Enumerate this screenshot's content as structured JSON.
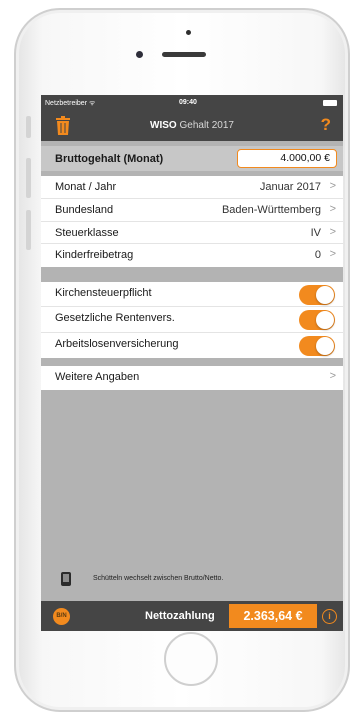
{
  "status_bar": {
    "carrier": "Netzbetreiber ᯤ",
    "time": "09:40"
  },
  "nav": {
    "title_bold": "WISO",
    "title_rest": " Gehalt 2017",
    "left_icon": "trash-icon",
    "right_icon": "help-icon",
    "help_glyph": "?"
  },
  "brutto": {
    "label": "Bruttogehalt (Monat)",
    "value": "4.000,00 €"
  },
  "settings": [
    {
      "label": "Monat / Jahr",
      "value": "Januar 2017"
    },
    {
      "label": "Bundesland",
      "value": "Baden-Württemberg"
    },
    {
      "label": "Steuerklasse",
      "value": "IV"
    },
    {
      "label": "Kinderfreibetrag",
      "value": "0"
    }
  ],
  "toggles": [
    {
      "label": "Kirchensteuerpflicht",
      "on": true
    },
    {
      "label": "Gesetzliche Rentenvers.",
      "on": true
    },
    {
      "label": "Arbeitslosenversicherung",
      "on": true
    }
  ],
  "more": {
    "label": "Weitere Angaben"
  },
  "chevron": ">",
  "hint": {
    "icon": "phone-shake-icon",
    "text": "Schütteln wechselt zwischen Brutto/Netto."
  },
  "bottom": {
    "bn_label": "B/N",
    "netto_label": "Nettozahlung",
    "netto_value": "2.363,64 €",
    "info_glyph": "i"
  },
  "colors": {
    "accent": "#f28a1e",
    "bar_dark": "#454545",
    "background_gray": "#b3b3b3"
  }
}
